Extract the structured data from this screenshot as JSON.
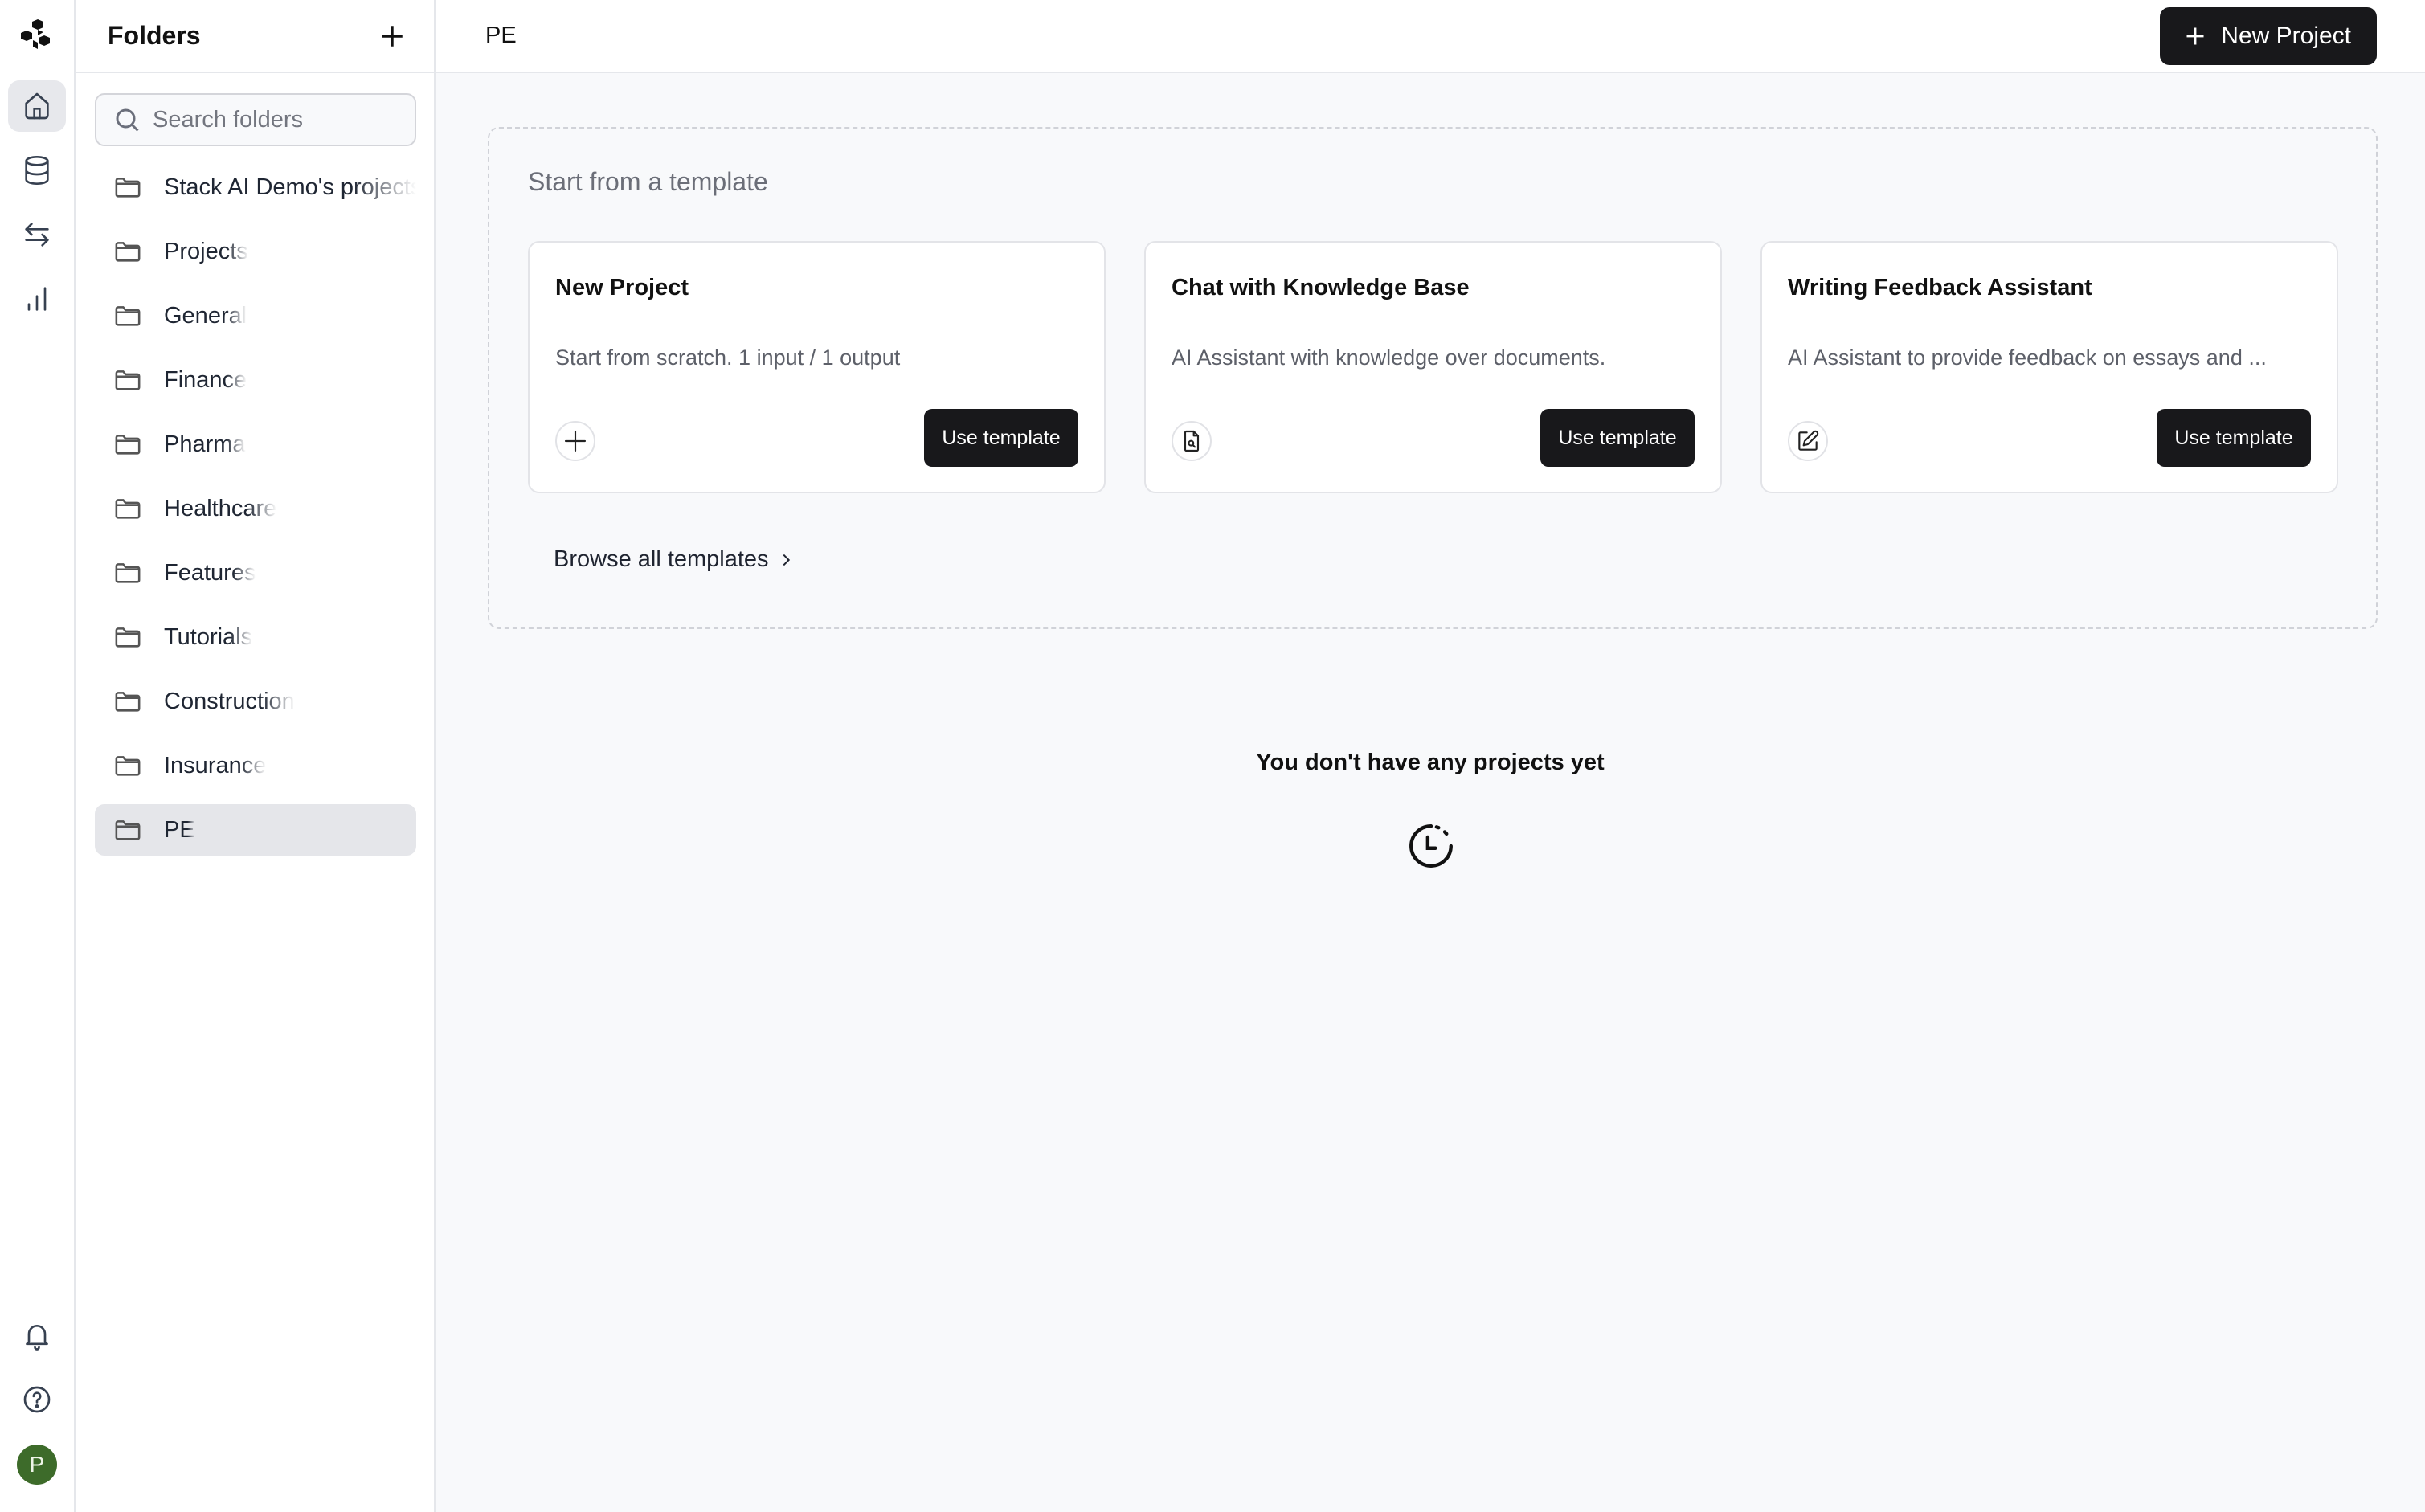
{
  "rail": {
    "items": [
      {
        "name": "home",
        "active": true
      },
      {
        "name": "knowledge-base",
        "active": false
      },
      {
        "name": "connections",
        "active": false
      },
      {
        "name": "analytics",
        "active": false
      }
    ],
    "bottom": [
      "notifications",
      "help"
    ],
    "avatar": {
      "initial": "P",
      "color": "#3d6b2a"
    }
  },
  "folders": {
    "title": "Folders",
    "search_placeholder": "Search folders",
    "items": [
      {
        "label": "Stack AI Demo's projects",
        "active": false
      },
      {
        "label": "Projects",
        "active": false
      },
      {
        "label": "General",
        "active": false
      },
      {
        "label": "Finance",
        "active": false
      },
      {
        "label": "Pharma",
        "active": false
      },
      {
        "label": "Healthcare",
        "active": false
      },
      {
        "label": "Features",
        "active": false
      },
      {
        "label": "Tutorials",
        "active": false
      },
      {
        "label": "Construction",
        "active": false
      },
      {
        "label": "Insurance",
        "active": false
      },
      {
        "label": "PE",
        "active": true
      }
    ]
  },
  "header": {
    "breadcrumb": "PE",
    "new_project_label": "New Project"
  },
  "templates": {
    "title": "Start from a template",
    "cards": [
      {
        "title": "New Project",
        "description": "Start from scratch. 1 input / 1 output",
        "icon": "plus-icon",
        "button": "Use template"
      },
      {
        "title": "Chat with Knowledge Base",
        "description": "AI Assistant with knowledge over documents.",
        "icon": "document-search-icon",
        "button": "Use template"
      },
      {
        "title": "Writing Feedback Assistant",
        "description": "AI Assistant to provide feedback on essays and ...",
        "icon": "edit-icon",
        "button": "Use template"
      }
    ],
    "browse_label": "Browse all templates"
  },
  "empty_state": {
    "message": "You don't have any projects yet",
    "icon": "clock-dashed-icon"
  },
  "colors": {
    "primary_button": "#18181b",
    "selected_row": "#e5e6ea",
    "background": "#f8f9fb"
  }
}
